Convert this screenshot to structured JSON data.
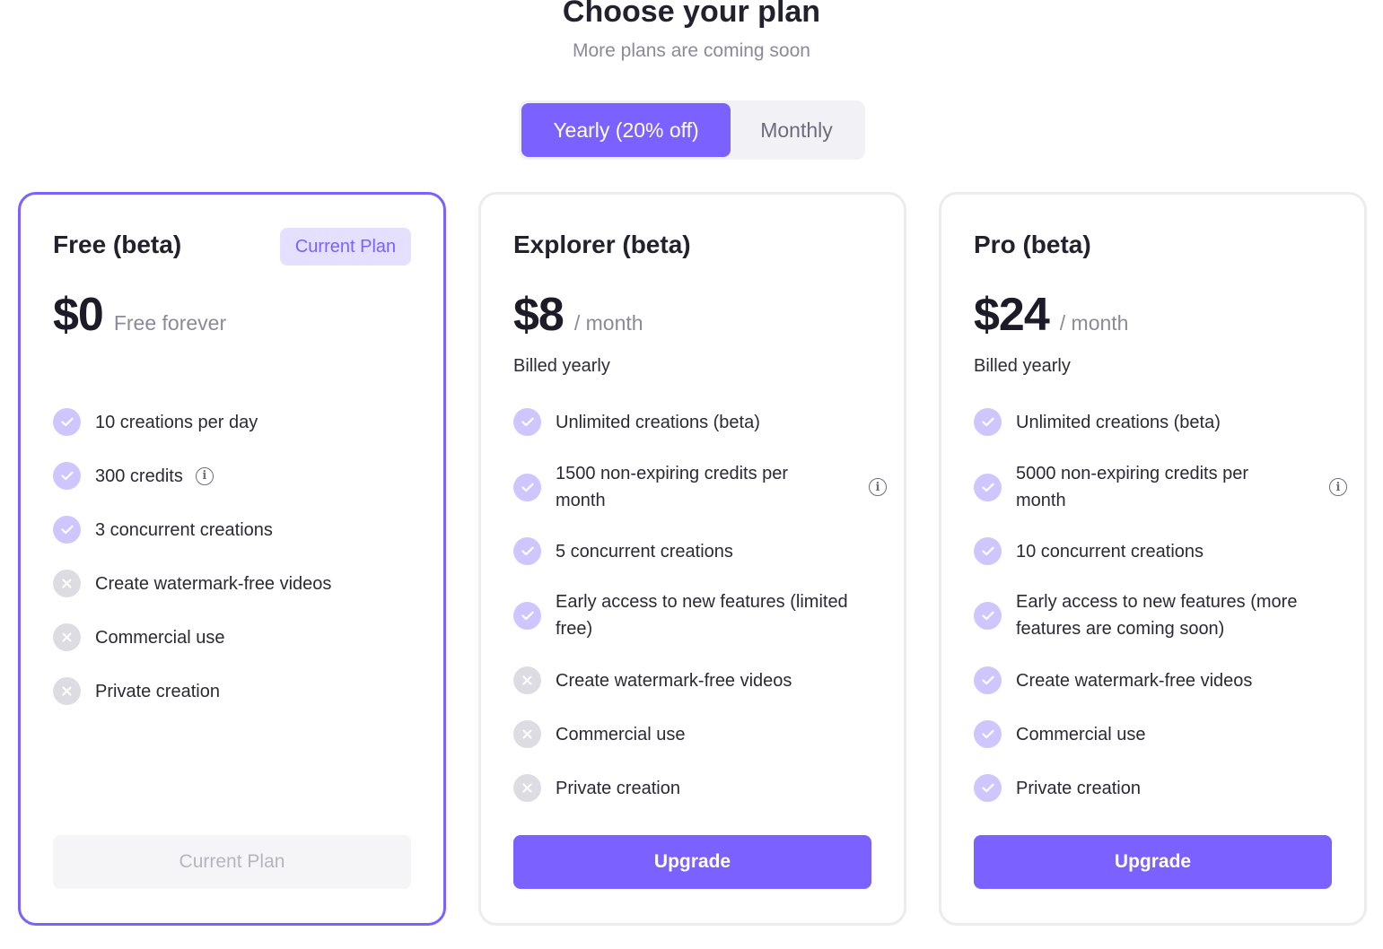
{
  "header": {
    "title": "Choose your plan",
    "subtitle": "More plans are coming soon"
  },
  "billing_toggle": {
    "options": [
      "Yearly (20% off)",
      "Monthly"
    ],
    "selected": "Yearly (20% off)"
  },
  "colors": {
    "accent": "#7b61ff",
    "check_bg": "#cfc6ff",
    "cross_bg": "#dcdce2",
    "badge_bg": "#e5e0ff"
  },
  "plans": [
    {
      "name": "Free (beta)",
      "badge": "Current Plan",
      "price": "$0",
      "period": "Free forever",
      "billed": "",
      "features": [
        {
          "text": "10 creations per day",
          "included": true
        },
        {
          "text": "300 credits",
          "included": true,
          "info": true
        },
        {
          "text": "3 concurrent creations",
          "included": true
        },
        {
          "text": "Create watermark-free videos",
          "included": false
        },
        {
          "text": "Commercial use",
          "included": false
        },
        {
          "text": "Private creation",
          "included": false
        }
      ],
      "button": "Current Plan"
    },
    {
      "name": "Explorer (beta)",
      "price": "$8",
      "period": "/ month",
      "billed": "Billed yearly",
      "features": [
        {
          "text": "Unlimited creations (beta)",
          "included": true
        },
        {
          "text": "1500 non-expiring credits per month",
          "included": true,
          "info": true
        },
        {
          "text": "5 concurrent creations",
          "included": true
        },
        {
          "text": "Early access to new features (limited free)",
          "included": true
        },
        {
          "text": "Create watermark-free videos",
          "included": false
        },
        {
          "text": "Commercial use",
          "included": false
        },
        {
          "text": "Private creation",
          "included": false
        }
      ],
      "button": "Upgrade"
    },
    {
      "name": "Pro (beta)",
      "price": "$24",
      "period": "/ month",
      "billed": "Billed yearly",
      "features": [
        {
          "text": "Unlimited creations (beta)",
          "included": true
        },
        {
          "text": "5000 non-expiring credits per month",
          "included": true,
          "info": true
        },
        {
          "text": "10 concurrent creations",
          "included": true
        },
        {
          "text": "Early access to new features (more features are coming soon)",
          "included": true
        },
        {
          "text": "Create watermark-free videos",
          "included": true
        },
        {
          "text": "Commercial use",
          "included": true
        },
        {
          "text": "Private creation",
          "included": true
        }
      ],
      "button": "Upgrade"
    }
  ]
}
